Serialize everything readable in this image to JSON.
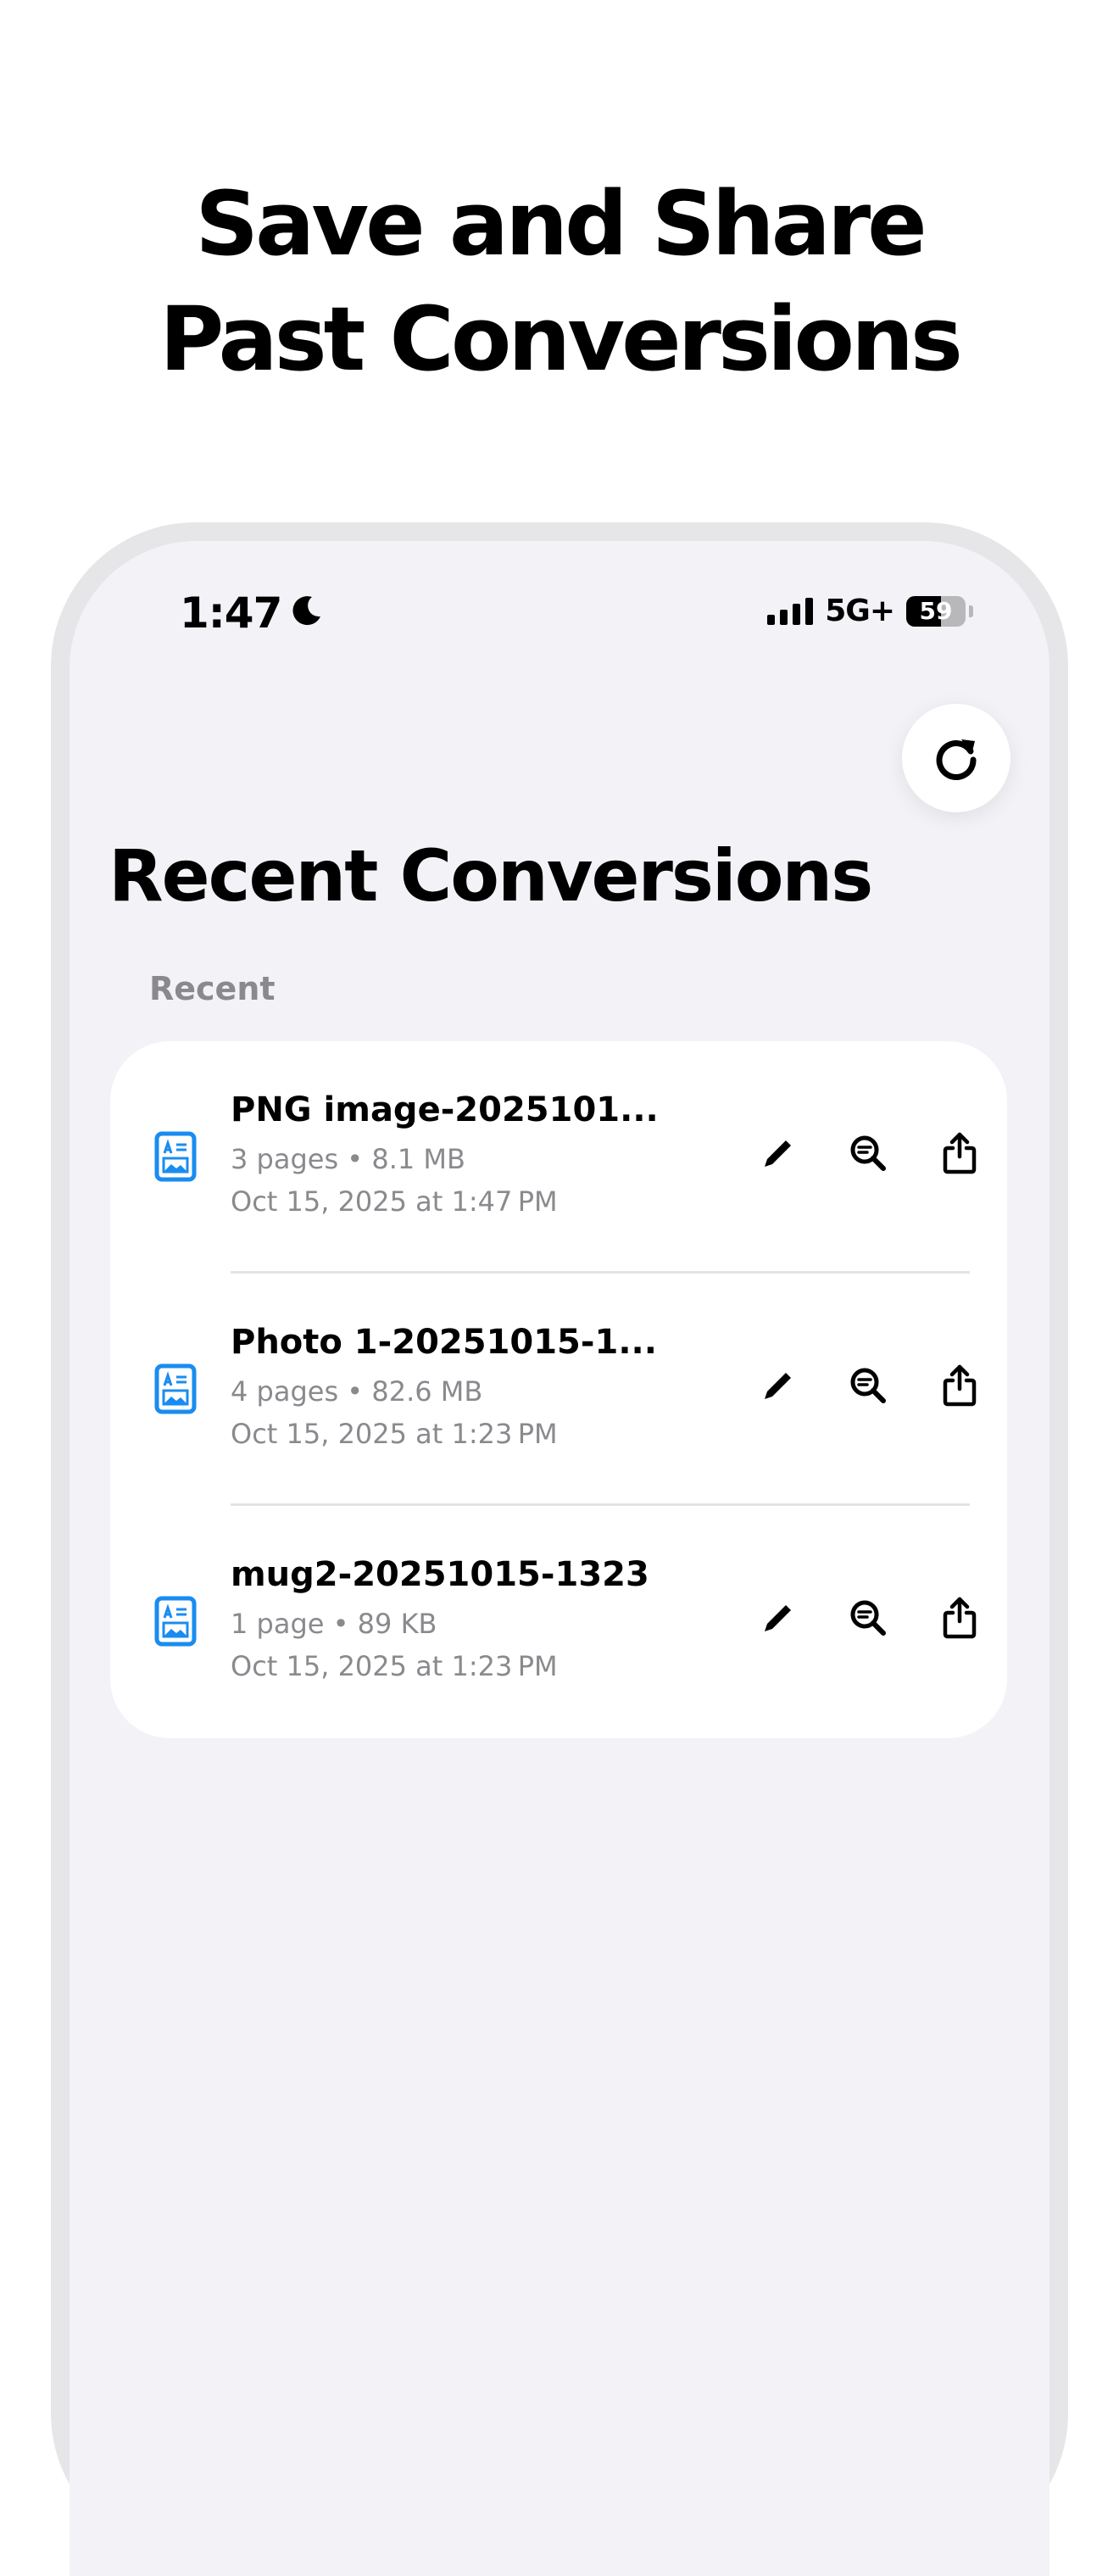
{
  "headline": {
    "line1": "Save and Share",
    "line2": "Past Conversions"
  },
  "status_bar": {
    "time": "1:47",
    "network": "5G+",
    "battery": "59",
    "battery_level": 0.59
  },
  "page_title": "Recent Conversions",
  "section_label": "Recent",
  "files": [
    {
      "name": "PNG image-2025101...",
      "meta": "3 pages • 8.1 MB",
      "date": "Oct 15, 2025 at 1:47 PM"
    },
    {
      "name": "Photo 1-20251015-1...",
      "meta": "4 pages • 82.6 MB",
      "date": "Oct 15, 2025 at 1:23 PM"
    },
    {
      "name": "mug2-20251015-1323",
      "meta": "1 page • 89 KB",
      "date": "Oct 15, 2025 at 1:23 PM"
    }
  ],
  "icons": {
    "status": "moon-icon",
    "refresh": "refresh-icon",
    "file": "document-image-icon",
    "edit": "pencil-icon",
    "preview": "magnify-text-icon",
    "share": "share-icon"
  },
  "colors": {
    "accent": "#1a8cf0",
    "background": "#f2f2f7",
    "card": "#ffffff",
    "secondary_text": "#8a8a8e"
  }
}
